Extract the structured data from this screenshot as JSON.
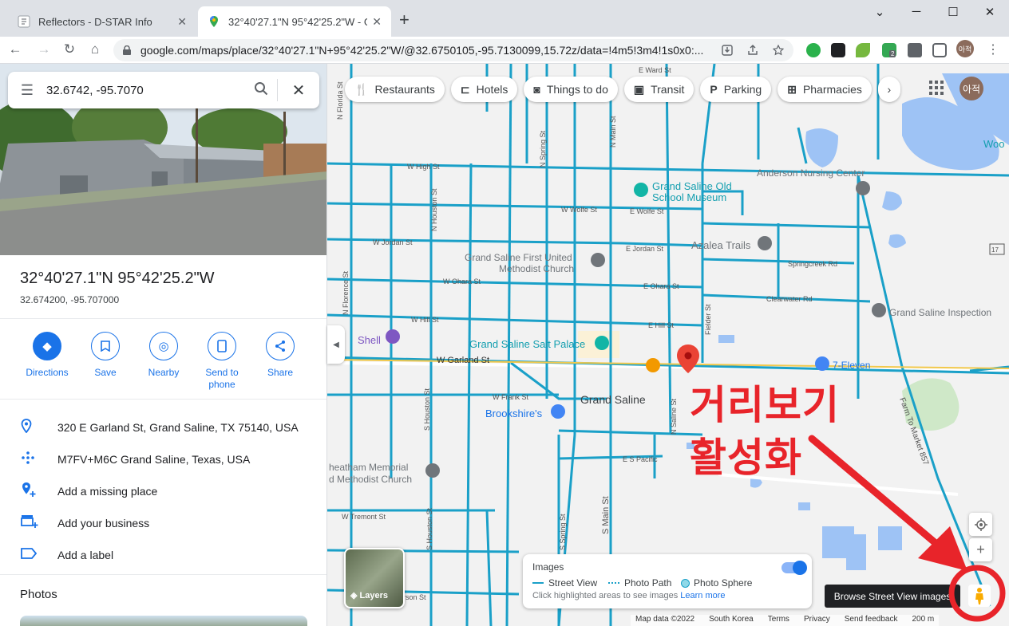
{
  "browser": {
    "tabs": [
      {
        "title": "Reflectors - D-STAR Info",
        "close": "✕"
      },
      {
        "title": "32°40'27.1\"N 95°42'25.2\"W - Go",
        "close": "✕"
      }
    ],
    "new_tab": "+",
    "window_controls": {
      "minimize": "─",
      "maximize": "☐",
      "close": "✕",
      "chevron": "⌄"
    },
    "nav": {
      "back": "←",
      "forward": "→",
      "reload": "↻",
      "home": "⌂"
    },
    "url": "google.com/maps/place/32°40'27.1\"N+95°42'25.2\"W/@32.6750105,-95.7130099,15.72z/data=!4m5!3m4!1s0x0:...",
    "extension_badge": "2",
    "profile_initial": "아적"
  },
  "left_panel": {
    "search": {
      "value": "32.6742, -95.7070"
    },
    "place": {
      "title": "32°40'27.1\"N 95°42'25.2\"W",
      "subtitle": "32.674200, -95.707000"
    },
    "actions": [
      {
        "label": "Directions",
        "icon": "directions-icon"
      },
      {
        "label": "Save",
        "icon": "bookmark-icon"
      },
      {
        "label": "Nearby",
        "icon": "nearby-icon"
      },
      {
        "label": "Send to phone",
        "icon": "phone-icon"
      },
      {
        "label": "Share",
        "icon": "share-icon"
      }
    ],
    "info": [
      {
        "text": "320 E Garland St, Grand Saline, TX 75140, USA",
        "icon": "pin-icon"
      },
      {
        "text": "M7FV+M6C Grand Saline, Texas, USA",
        "icon": "plus-code-icon"
      },
      {
        "text": "Add a missing place",
        "icon": "add-place-icon"
      },
      {
        "text": "Add your business",
        "icon": "business-icon"
      },
      {
        "text": "Add a label",
        "icon": "label-icon"
      }
    ],
    "photos_heading": "Photos"
  },
  "map": {
    "chips": [
      {
        "label": "Restaurants",
        "icon": "fork-knife-icon"
      },
      {
        "label": "Hotels",
        "icon": "bed-icon"
      },
      {
        "label": "Things to do",
        "icon": "camera-icon"
      },
      {
        "label": "Transit",
        "icon": "bus-icon"
      },
      {
        "label": "Parking",
        "icon": "parking-icon"
      },
      {
        "label": "Pharmacies",
        "icon": "pharmacy-icon"
      }
    ],
    "avatar": "아적",
    "places": {
      "grand_saline_old_school_museum_1": "Grand Saline Old",
      "grand_saline_old_school_museum_2": "School Museum",
      "anderson_nursing_center": "Anderson Nursing Center",
      "azalea_trails": "Azalea Trails",
      "grand_saline_first_umc_1": "Grand Saline First United",
      "grand_saline_first_umc_2": "Methodist Church",
      "grand_saline_inspection": "Grand Saline Inspection",
      "shell": "Shell",
      "salt_palace": "Grand Saline Salt Palace",
      "seven_eleven": "7-Eleven",
      "grand_saline": "Grand Saline",
      "brookshires": "Brookshire's",
      "cheatham_1": "heatham Memorial",
      "cheatham_2": "d Methodist Church",
      "woo": "Woo"
    },
    "streets": {
      "w_high": "W High St",
      "w_wolfe": "W Wolfe St",
      "e_wolfe": "E Wolfe St",
      "w_jordan": "W Jordan St",
      "e_jordan": "E Jordan St",
      "w_ohara": "W Ohara St",
      "e_ohara": "E Ohara St",
      "w_hill": "W Hill St",
      "e_hill": "E Hill St",
      "w_garland": "W Garland St",
      "w_frank": "W Frank St",
      "e_s_pacific": "E S Pacific",
      "w_tremont": "W Tremont St",
      "e_ward": "E Ward St",
      "springcreek": "Springcreek Rd",
      "clearwater": "Clearwater Rd",
      "n_houston": "N Houston St",
      "s_houston": "S Houston St",
      "n_florence": "N Florence St",
      "n_spring": "N Spring St",
      "n_main": "N Main St",
      "s_main": "S Main St",
      "s_spring": "S Spring St",
      "n_saline": "N Saline St",
      "fielder": "Fielder St",
      "farm_to_market": "Farm To Market 857",
      "n_florida": "N Florida St",
      "hwy17": "17",
      "son_st": "rson St"
    },
    "layers_label": "Layers",
    "images_panel": {
      "title": "Images",
      "legend": [
        "Street View",
        "Photo Path",
        "Photo Sphere"
      ],
      "hint": "Click highlighted areas to see images",
      "learn_more": "Learn more"
    },
    "tooltip": "Browse Street View images",
    "footer": [
      "Map data ©2022",
      "South Korea",
      "Terms",
      "Privacy",
      "Send feedback",
      "200 m"
    ],
    "annotation": {
      "line1": "거리보기",
      "line2": "활성화"
    },
    "colors": {
      "street_view": "#1aa0c8",
      "annotation": "#e8242a",
      "accent": "#1a73e8"
    }
  }
}
